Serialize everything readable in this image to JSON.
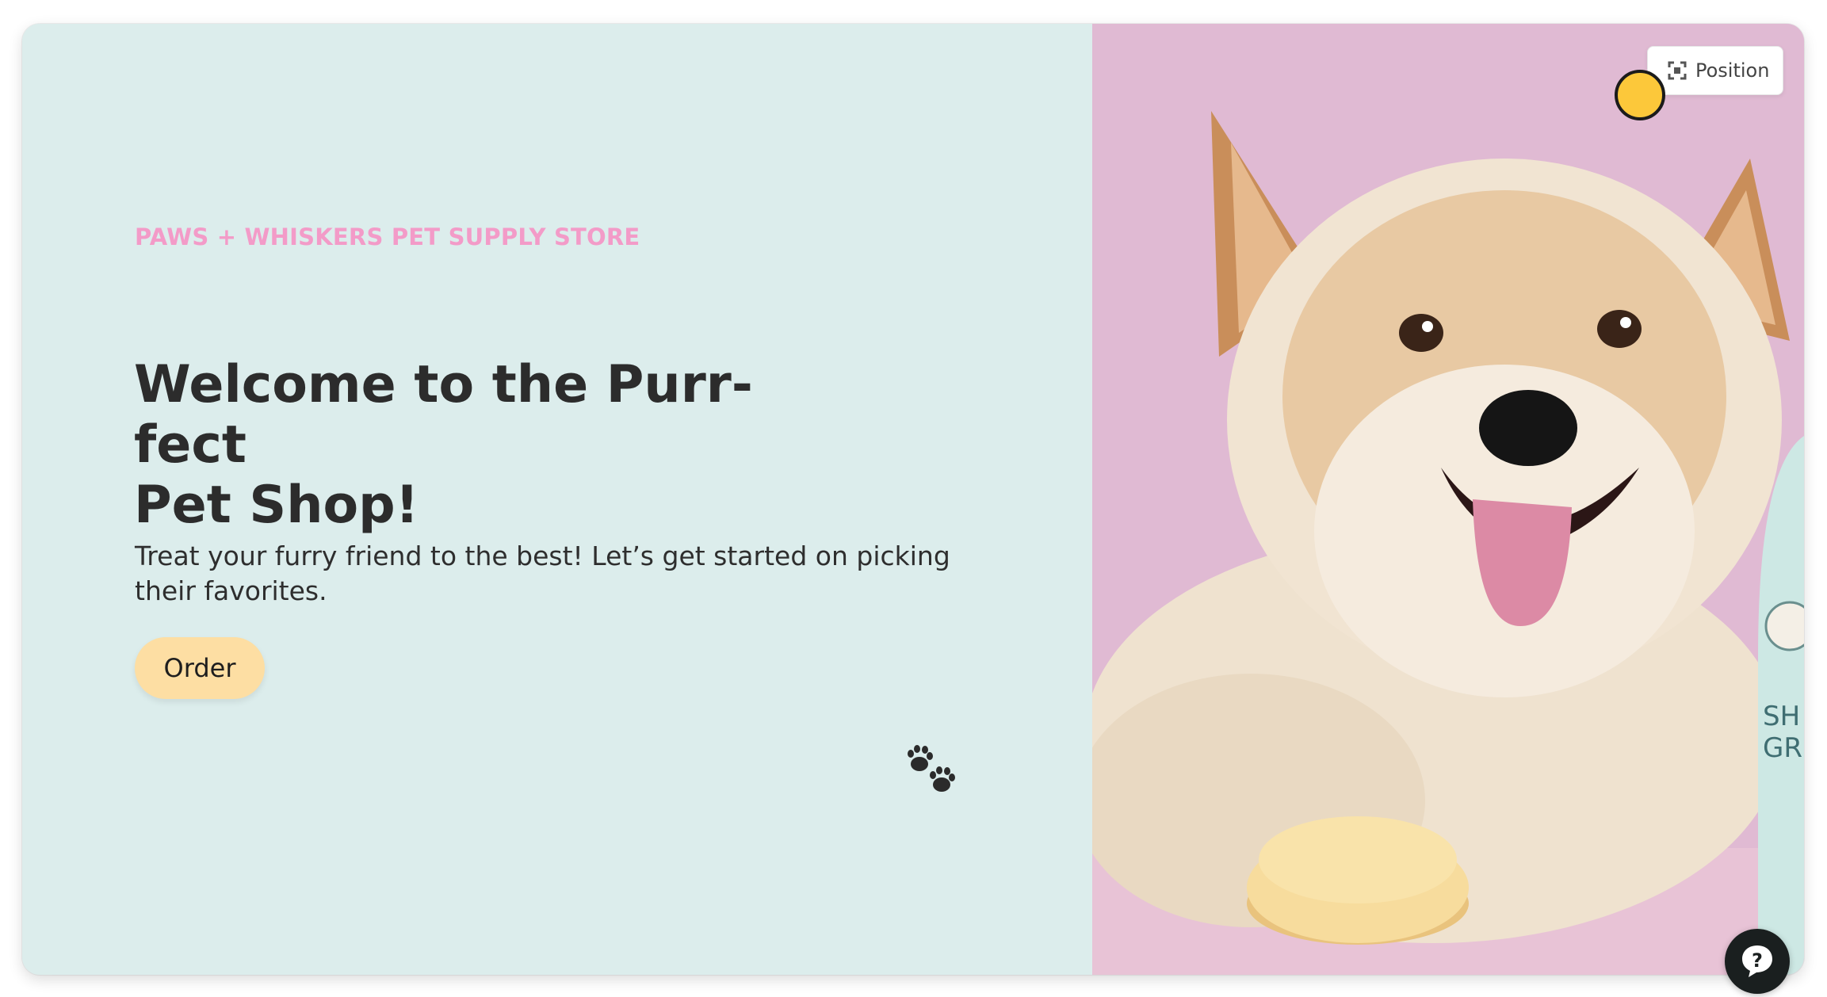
{
  "hero": {
    "store_name": "PAWS + WHISKERS PET SUPPLY STORE",
    "headline_line1": "Welcome to the Purr-fect",
    "headline_line2": "Pet Shop!",
    "subtext": "Treat your furry friend to the best! Let’s get started on picking their favorites.",
    "order_label": "Order"
  },
  "toolbar": {
    "position_label": "Position"
  },
  "help": {
    "symbol": "?"
  },
  "image": {
    "bottle_text_line1": "SH",
    "bottle_text_line2": "GR"
  },
  "colors": {
    "panel_bg": "#dcedec",
    "brand_pink": "#f39bc8",
    "order_button": "#fddea3",
    "photo_bg": "#e1b9d4",
    "cursor": "#fcc83a"
  },
  "icons": [
    "paw-prints-icon",
    "expand-icon",
    "help-icon"
  ]
}
